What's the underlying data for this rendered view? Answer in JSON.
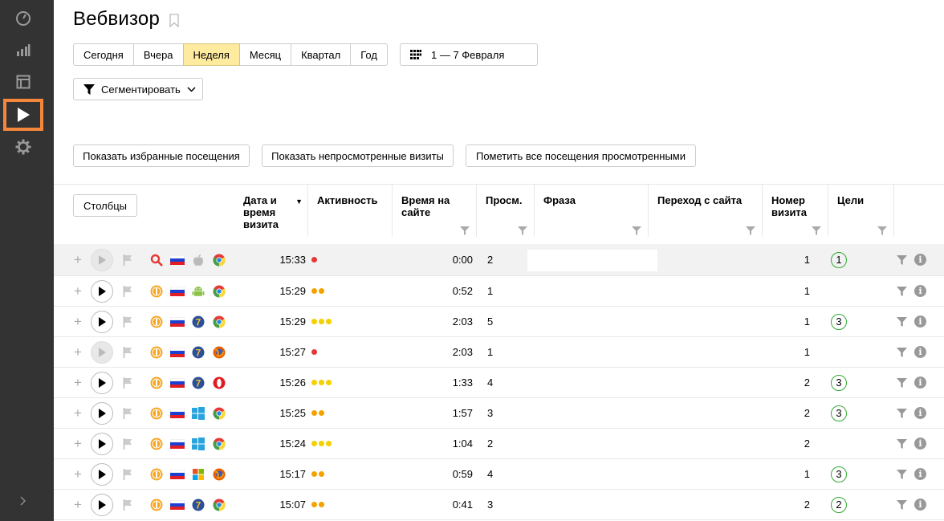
{
  "sidebar": {
    "items": [
      {
        "name": "dashboard-icon"
      },
      {
        "name": "reports-icon"
      },
      {
        "name": "maps-icon"
      },
      {
        "name": "webvisor-icon"
      },
      {
        "name": "settings-icon"
      }
    ],
    "active_color": "#f5873d",
    "collapse_icon": "chevron-right-icon"
  },
  "header": {
    "title": "Вебвизор"
  },
  "period": {
    "options": [
      "Сегодня",
      "Вчера",
      "Неделя",
      "Месяц",
      "Квартал",
      "Год"
    ],
    "selected": "Неделя",
    "date_range": "1 — 7 Февраля"
  },
  "segment_button": "Сегментировать",
  "actions": {
    "show_favorites": "Показать избранные посещения",
    "show_unviewed": "Показать непросмотренные визиты",
    "mark_all_viewed": "Пометить все посещения просмотренными"
  },
  "table": {
    "columns_button": "Столбцы",
    "headers": {
      "date": "Дата и время визита",
      "activity": "Активность",
      "duration": "Время на сайте",
      "views": "Просм.",
      "phrase": "Фраза",
      "referrer": "Переход с сайта",
      "visit_number": "Номер визита",
      "goals": "Цели"
    },
    "rows": [
      {
        "time": "15:33",
        "activity": 1,
        "activity_color": "#e53935",
        "duration": "0:00",
        "views": "2",
        "visit_number": "1",
        "goal": "1",
        "source": "search-icon",
        "os": "apple-icon",
        "browser": "chrome-icon",
        "played": false
      },
      {
        "time": "15:29",
        "activity": 2,
        "activity_color": "#f5a200",
        "duration": "0:52",
        "views": "1",
        "visit_number": "1",
        "goal": "",
        "source": "yandex-direct-icon",
        "os": "android-icon",
        "browser": "chrome-icon",
        "played": true
      },
      {
        "time": "15:29",
        "activity": 3,
        "activity_color": "#f5d000",
        "duration": "2:03",
        "views": "5",
        "visit_number": "1",
        "goal": "3",
        "source": "yandex-direct-icon",
        "os": "windows7-icon",
        "browser": "chrome-icon",
        "played": true
      },
      {
        "time": "15:27",
        "activity": 1,
        "activity_color": "#e53935",
        "duration": "2:03",
        "views": "1",
        "visit_number": "1",
        "goal": "",
        "source": "yandex-direct-icon",
        "os": "windows7-icon",
        "browser": "firefox-icon",
        "played": false
      },
      {
        "time": "15:26",
        "activity": 3,
        "activity_color": "#f5d000",
        "duration": "1:33",
        "views": "4",
        "visit_number": "2",
        "goal": "3",
        "source": "yandex-direct-icon",
        "os": "windows7-icon",
        "browser": "opera-icon",
        "played": true
      },
      {
        "time": "15:25",
        "activity": 2,
        "activity_color": "#f5a200",
        "duration": "1:57",
        "views": "3",
        "visit_number": "2",
        "goal": "3",
        "source": "yandex-direct-icon",
        "os": "windows8-icon",
        "browser": "chrome-icon",
        "played": true
      },
      {
        "time": "15:24",
        "activity": 3,
        "activity_color": "#f5d000",
        "duration": "1:04",
        "views": "2",
        "visit_number": "2",
        "goal": "",
        "source": "yandex-direct-icon",
        "os": "windows8-icon",
        "browser": "chrome-icon",
        "played": true
      },
      {
        "time": "15:17",
        "activity": 2,
        "activity_color": "#f5a200",
        "duration": "0:59",
        "views": "4",
        "visit_number": "1",
        "goal": "3",
        "source": "yandex-direct-icon",
        "os": "windows-xp-icon",
        "browser": "firefox-icon",
        "played": true
      },
      {
        "time": "15:07",
        "activity": 2,
        "activity_color": "#f5a200",
        "duration": "0:41",
        "views": "3",
        "visit_number": "2",
        "goal": "2",
        "source": "yandex-direct-icon",
        "os": "windows7-icon",
        "browser": "chrome-icon",
        "played": true
      }
    ]
  }
}
